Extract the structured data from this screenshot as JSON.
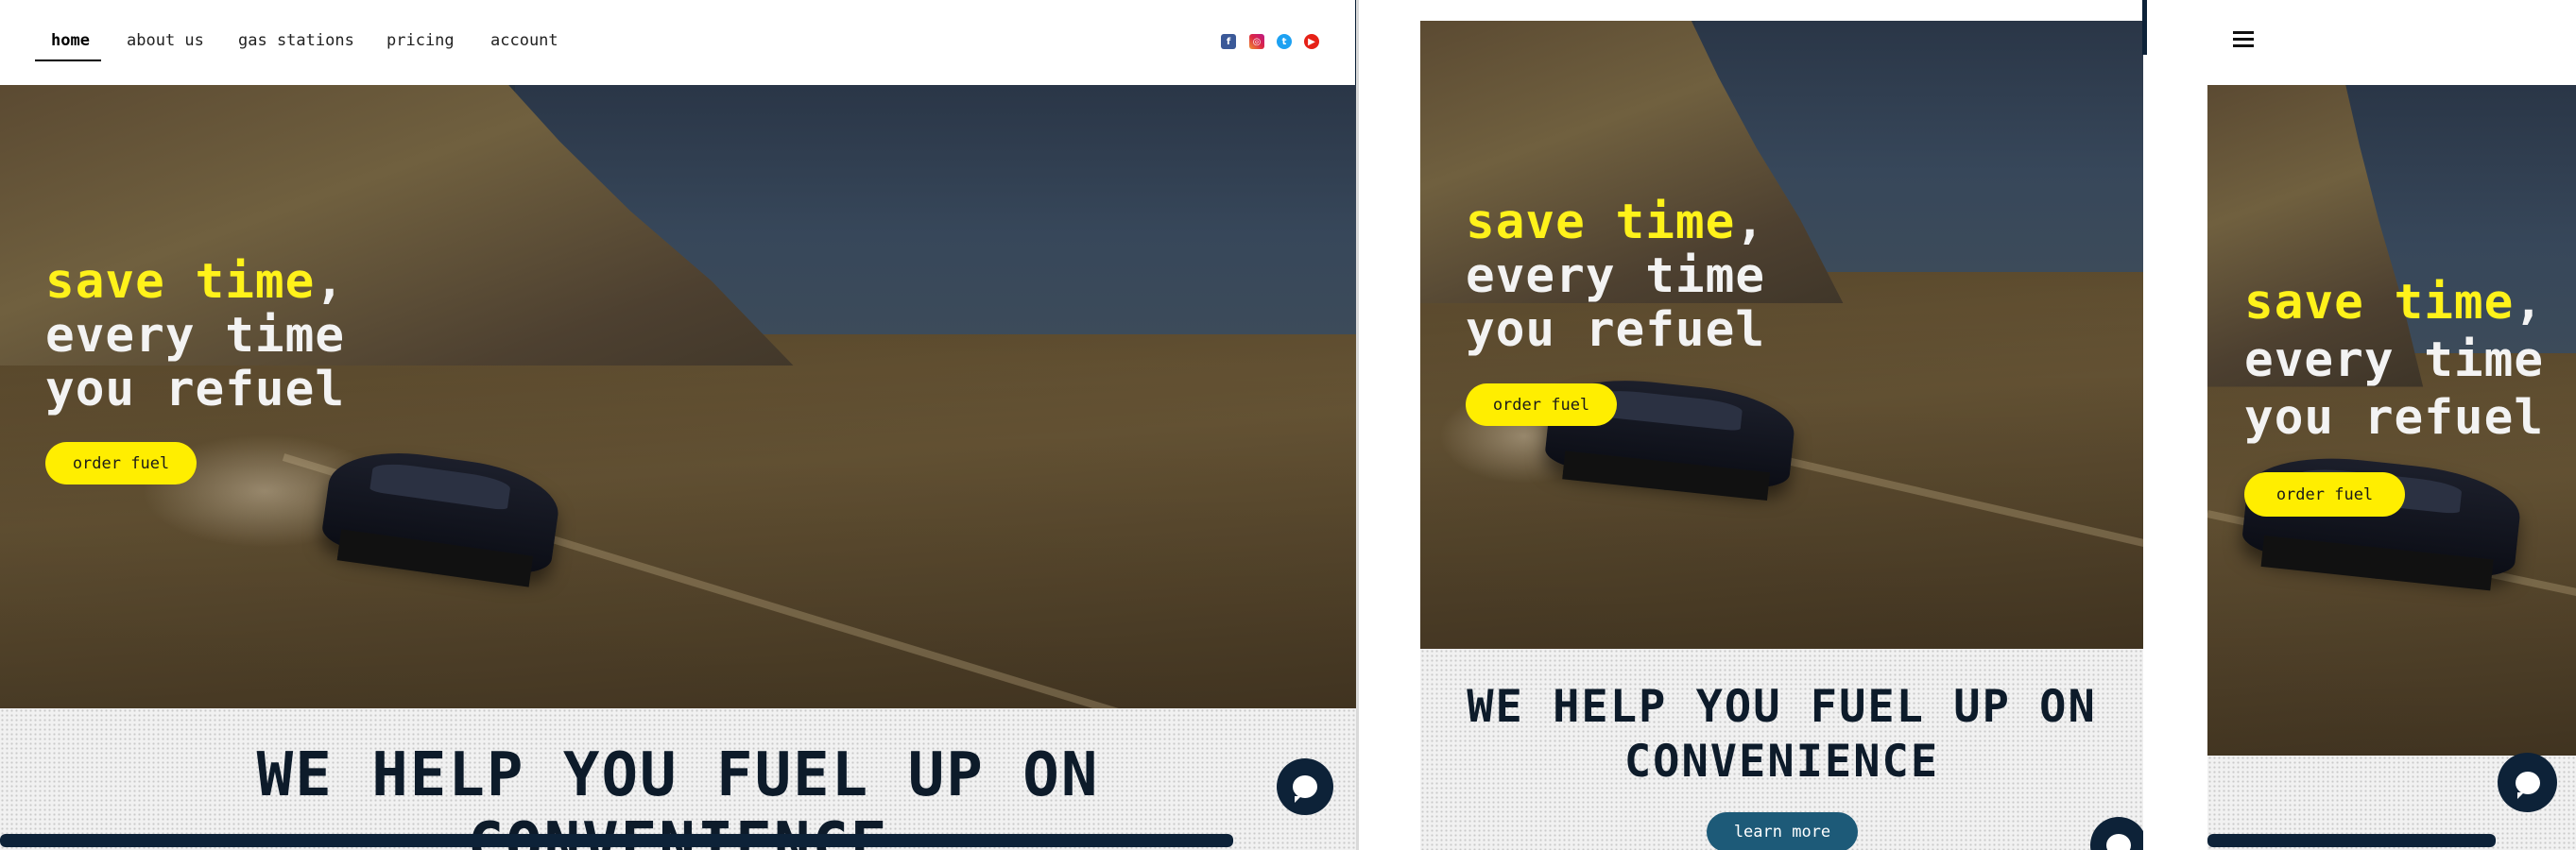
{
  "nav": {
    "items": [
      {
        "label": "home",
        "active": true
      },
      {
        "label": "about us",
        "active": false
      },
      {
        "label": "gas stations",
        "active": false
      },
      {
        "label": "pricing",
        "active": false
      },
      {
        "label": "account",
        "active": false
      }
    ],
    "social_icons": [
      "facebook-icon",
      "instagram-icon",
      "twitter-icon",
      "youtube-icon"
    ]
  },
  "hero": {
    "headline_highlight": "save time",
    "headline_comma": ",",
    "headline_line2": "every time",
    "headline_line3": "you refuel",
    "cta_label": "order fuel"
  },
  "section": {
    "heading": "WE HELP YOU FUEL UP ON CONVENIENCE",
    "heading_line1": "WE HELP YOU FUEL UP ON",
    "heading_line2": "CONVENIENCE",
    "learn_more_label": "learn more"
  },
  "menu_icon": "hamburger-icon",
  "chat_icon": "chat-bubble-icon",
  "colors": {
    "accent_yellow": "#ffee00",
    "navy": "#0d1b2a",
    "teal": "#1d5a78"
  }
}
